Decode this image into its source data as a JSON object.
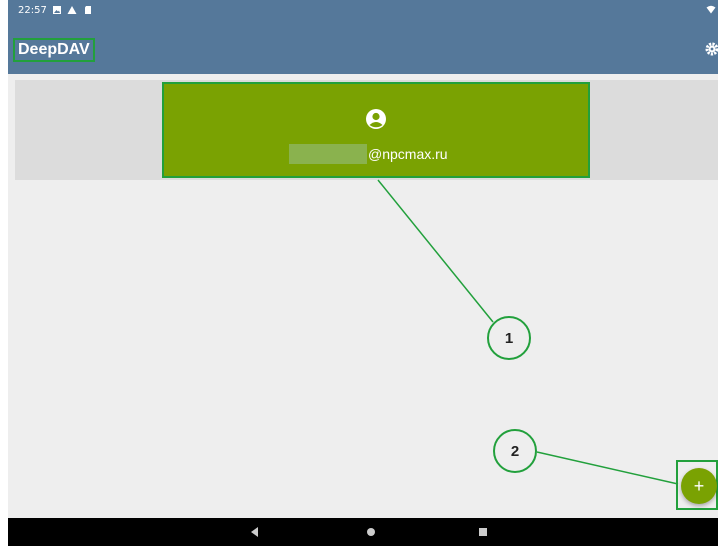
{
  "status_bar": {
    "time": "22:57",
    "icons": [
      "image-icon",
      "warning-icon",
      "sd-card-icon",
      "wifi-icon"
    ]
  },
  "app_bar": {
    "title": "DeepDAV",
    "settings_icon": "gear-icon",
    "color": "#55789a"
  },
  "account": {
    "icon": "account-circle-icon",
    "email_domain": "@npcmax.ru",
    "card_color": "#7aa202"
  },
  "annotations": {
    "callout_1": "1",
    "callout_2": "2",
    "color": "#22a03c"
  },
  "fab": {
    "label": "+",
    "icon": "add-icon"
  },
  "nav_bar": {
    "items": [
      "back-icon",
      "home-icon",
      "recents-icon"
    ]
  }
}
